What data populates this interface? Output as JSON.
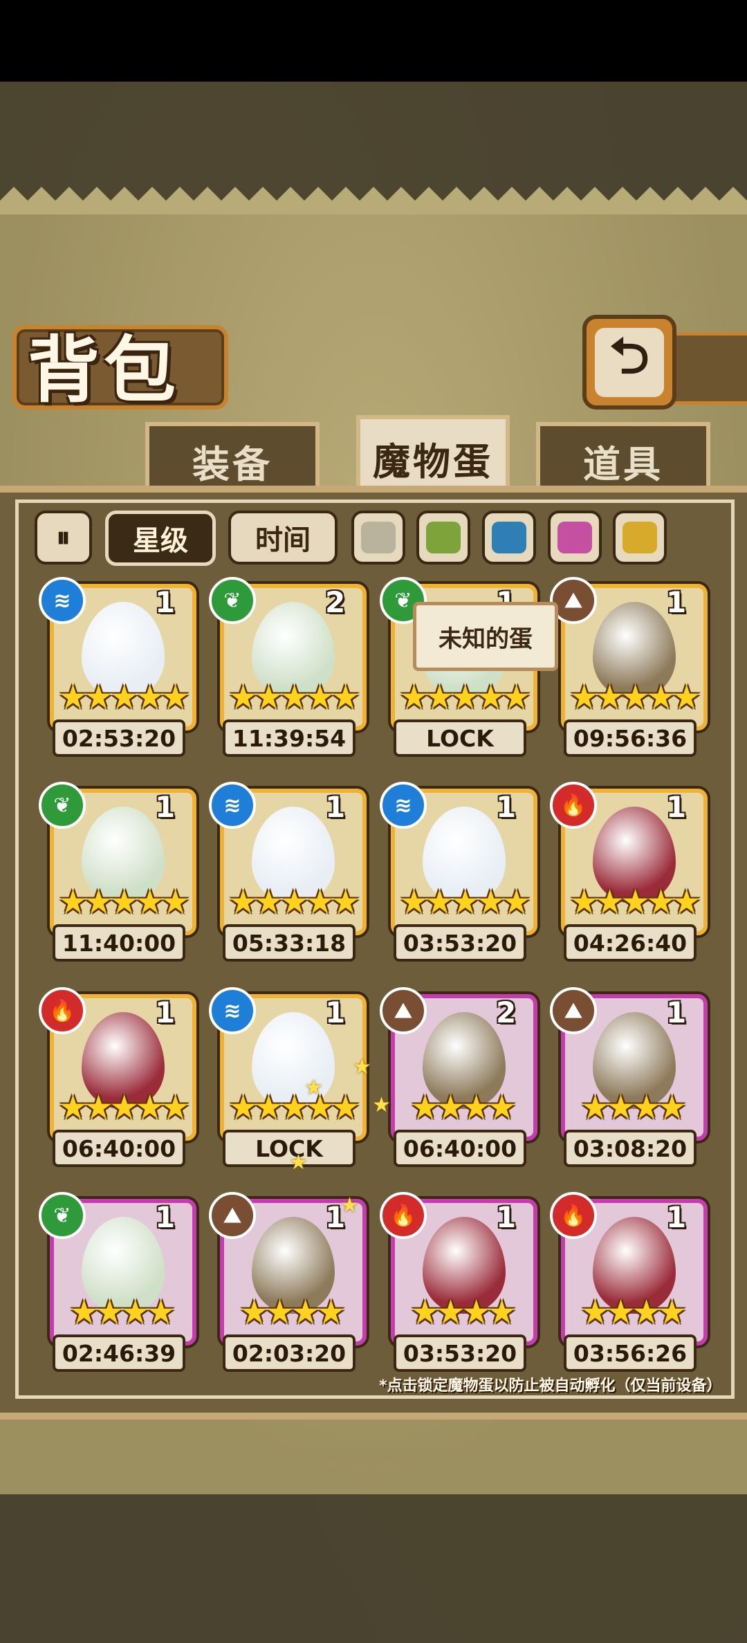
{
  "title": "背包",
  "back_icon": "⮌",
  "tabs": [
    {
      "label": "装备",
      "active": false
    },
    {
      "label": "魔物蛋",
      "active": true
    },
    {
      "label": "道具",
      "active": false
    }
  ],
  "filters": {
    "sort_icon": "⏸",
    "star_label": "星级",
    "time_label": "时间",
    "colors": [
      "#b9b39e",
      "#7fa33b",
      "#2d7fb6",
      "#c54fa0",
      "#d7aa2b"
    ]
  },
  "tooltip": "未知的蛋",
  "eggs": [
    {
      "element": "water",
      "count": "1",
      "stars": "★★★★★",
      "timer": "02:53:20",
      "rarity": "gold"
    },
    {
      "element": "nature",
      "count": "2",
      "stars": "★★★★★",
      "timer": "11:39:54",
      "rarity": "gold"
    },
    {
      "element": "nature",
      "count": "1",
      "stars": "★★★★★",
      "timer": "LOCK",
      "rarity": "gold"
    },
    {
      "element": "earth",
      "count": "1",
      "stars": "★★★★★",
      "timer": "09:56:36",
      "rarity": "gold"
    },
    {
      "element": "nature",
      "count": "1",
      "stars": "★★★★★",
      "timer": "11:40:00",
      "rarity": "gold"
    },
    {
      "element": "water",
      "count": "1",
      "stars": "★★★★★",
      "timer": "05:33:18",
      "rarity": "gold"
    },
    {
      "element": "water",
      "count": "1",
      "stars": "★★★★★",
      "timer": "03:53:20",
      "rarity": "gold"
    },
    {
      "element": "fire",
      "count": "1",
      "stars": "★★★★★",
      "timer": "04:26:40",
      "rarity": "gold"
    },
    {
      "element": "fire",
      "count": "1",
      "stars": "★★★★★",
      "timer": "06:40:00",
      "rarity": "gold"
    },
    {
      "element": "water",
      "count": "1",
      "stars": "★★★★★",
      "timer": "LOCK",
      "rarity": "gold"
    },
    {
      "element": "earth",
      "count": "2",
      "stars": "★★★★",
      "timer": "06:40:00",
      "rarity": "epic"
    },
    {
      "element": "earth",
      "count": "1",
      "stars": "★★★★",
      "timer": "03:08:20",
      "rarity": "epic"
    },
    {
      "element": "nature",
      "count": "1",
      "stars": "★★★★",
      "timer": "02:46:39",
      "rarity": "epic"
    },
    {
      "element": "earth",
      "count": "1",
      "stars": "★★★★",
      "timer": "02:03:20",
      "rarity": "epic"
    },
    {
      "element": "fire",
      "count": "1",
      "stars": "★★★★",
      "timer": "03:53:20",
      "rarity": "epic"
    },
    {
      "element": "fire",
      "count": "1",
      "stars": "★★★★",
      "timer": "03:56:26",
      "rarity": "epic"
    }
  ],
  "hint": "*点击锁定魔物蛋以防止被自动孵化（仅当前设备）"
}
